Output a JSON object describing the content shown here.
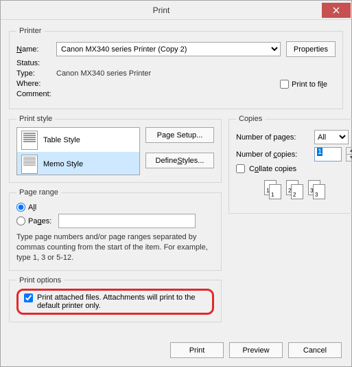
{
  "window": {
    "title": "Print"
  },
  "printer": {
    "legend": "Printer",
    "name_label_pre": "N",
    "name_label_rest": "ame:",
    "name_value": "Canon MX340 series Printer (Copy 2)",
    "properties_button": "Properties",
    "status_label": "Status:",
    "status_value": "",
    "type_label": "Type:",
    "type_value": "Canon MX340 series Printer",
    "where_label": "Where:",
    "where_value": "",
    "comment_label": "Comment:",
    "comment_value": "",
    "print_to_file_pre": "Print to fi",
    "print_to_file_u": "l",
    "print_to_file_post": "e"
  },
  "print_style": {
    "legend": "Print style",
    "items": [
      {
        "label": "Table Style"
      },
      {
        "label": "Memo Style"
      }
    ],
    "page_setup_button": "Page Setup...",
    "define_styles_pre": "Define ",
    "define_styles_u": "S",
    "define_styles_post": "tyles..."
  },
  "copies": {
    "legend": "Copies",
    "pages_label": "Number of pages:",
    "pages_value": "All",
    "copies_label_pre": "Number of ",
    "copies_label_u": "c",
    "copies_label_post": "opies:",
    "copies_value": "1",
    "collate_pre": "C",
    "collate_u": "o",
    "collate_post": "llate copies"
  },
  "page_range": {
    "legend": "Page range",
    "all_pre": "A",
    "all_u": "l",
    "all_post": "l",
    "pages_label_pre": "Pa",
    "pages_label_u": "g",
    "pages_label_post": "es:",
    "pages_value": "",
    "note": "Type page numbers and/or page ranges separated by commas counting from the start of the item.  For example, type 1, 3 or 5-12."
  },
  "print_options": {
    "legend": "Print options",
    "attach_text": "Print attached files.  Attachments will print to the default printer only."
  },
  "footer": {
    "print_button": "Print",
    "preview_button": "Preview",
    "cancel_button": "Cancel"
  }
}
